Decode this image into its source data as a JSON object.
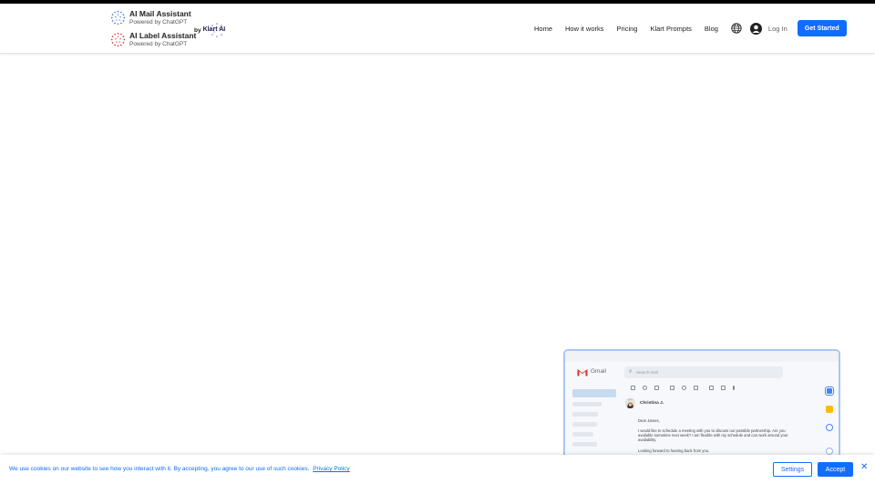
{
  "header": {
    "brands": [
      {
        "title": "AI Mail Assistant",
        "subtitle": "Powered by ChatGPT",
        "icon": "mail-assistant-logo-icon"
      },
      {
        "title": "AI Label Assistant",
        "subtitle": "Powered by ChatGPT",
        "icon": "label-assistant-logo-icon"
      }
    ],
    "by_text": "by",
    "klart_text": "Klart AI",
    "nav": [
      "Home",
      "How it works",
      "Pricing",
      "Klart Prompts",
      "Blog"
    ],
    "globe_icon": "globe-icon",
    "avatar_icon": "user-avatar-icon",
    "login": "Log In",
    "cta": "Get Started"
  },
  "preview": {
    "app_name": "Gmail",
    "search_placeholder": "Search mail",
    "sender": "Christina J.",
    "greeting": "Dear James,",
    "body": "I would like to schedule a meeting with you to discuss our possible partnership. Are you available sometime next week? I am flexible with my schedule and can work around your availability.",
    "closing": "Looking forward to hearing back from you."
  },
  "cookie": {
    "text": "We use cookies on our website to see how you interact with it. By accepting, you agree to our use of such cookies.",
    "link": "Privacy Policy",
    "settings": "Settings",
    "accept": "Accept",
    "close_icon": "close-icon"
  },
  "colors": {
    "accent": "#116dff",
    "top_strip": "#000000"
  }
}
